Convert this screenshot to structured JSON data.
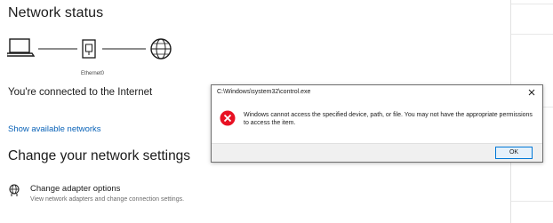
{
  "settings": {
    "network_status_title": "Network status",
    "diagram": {
      "adapter_name": "Ethernet0",
      "left_icon": "laptop-icon",
      "middle_icon": "ethernet-port-icon",
      "right_icon": "globe-icon"
    },
    "connection_status": "You're connected to the Internet",
    "show_networks_link": "Show available networks",
    "change_settings_title": "Change your network settings",
    "adapter_option": {
      "icon": "adapter-globe-icon",
      "title": "Change adapter options",
      "description": "View network adapters and change connection settings."
    }
  },
  "dialog": {
    "title": "C:\\Windows\\system32\\control.exe",
    "icon": "error-icon",
    "message": "Windows cannot access the specified device, path, or file. You may not have the appropriate permissions to access the item.",
    "ok_label": "OK",
    "close_icon": "close-icon"
  },
  "colors": {
    "link": "#0a63b8",
    "error_red": "#e81123",
    "accent_border": "#0078d7"
  }
}
